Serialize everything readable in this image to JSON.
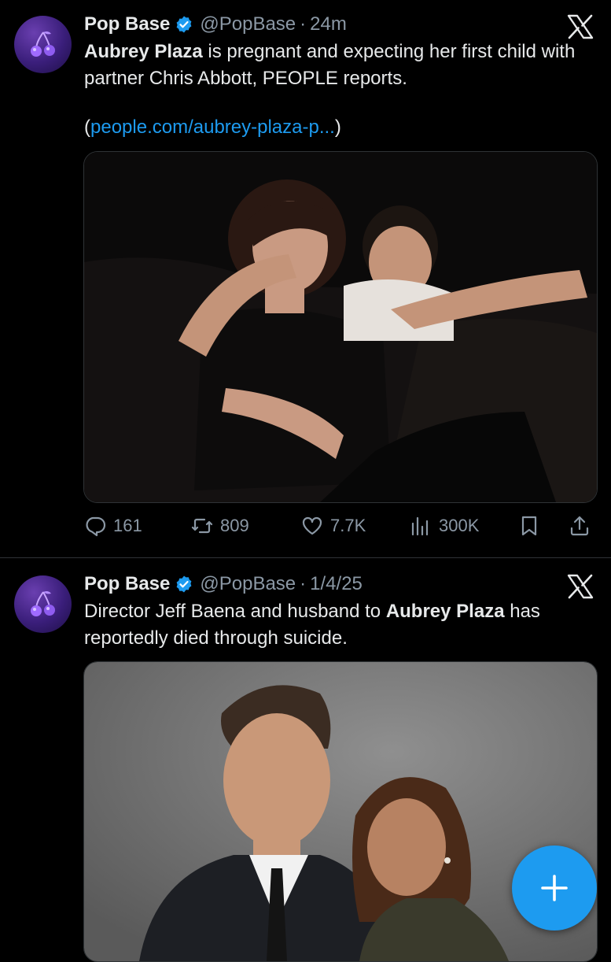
{
  "tweets": [
    {
      "author_name": "Pop Base",
      "handle": "@PopBase",
      "separator": "·",
      "time": "24m",
      "text_bold_1": "Aubrey Plaza",
      "text_1": " is pregnant and expecting her first child with partner Chris Abbott, PEOPLE reports.",
      "link_open": "(",
      "link_text": "people.com/aubrey-plaza-p...",
      "link_close": ")",
      "actions": {
        "replies": "161",
        "retweets": "809",
        "likes": "7.7K",
        "views": "300K"
      }
    },
    {
      "author_name": "Pop Base",
      "handle": "@PopBase",
      "separator": "·",
      "time": "1/4/25",
      "text_1": "Director Jeff Baena and husband to ",
      "text_bold_1": "Aubrey Plaza",
      "text_2": " has reportedly died through suicide."
    }
  ],
  "colors": {
    "background": "#000000",
    "accent": "#1d9bf0",
    "muted": "#8b98a5",
    "text": "#e7e9ea"
  },
  "icons": {
    "avatar": "cherry-icon",
    "platform": "x-logo-icon",
    "verified": "verified-badge-icon",
    "reply": "reply-icon",
    "retweet": "retweet-icon",
    "like": "heart-icon",
    "views": "views-icon",
    "bookmark": "bookmark-icon",
    "share": "share-icon",
    "compose": "plus-icon"
  }
}
